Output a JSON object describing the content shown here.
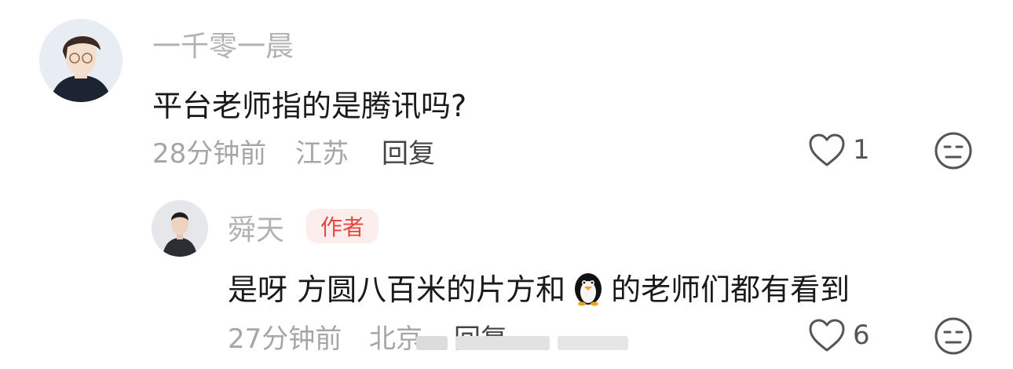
{
  "comment": {
    "username": "一千零一晨",
    "text": "平台老师指的是腾讯吗?",
    "time": "28分钟前",
    "location": "江苏",
    "reply_label": "回复",
    "likes": "1"
  },
  "reply": {
    "username": "舜天",
    "badge": "作者",
    "text_before": "是呀 方圆八百米的片方和",
    "text_after": "的老师们都有看到",
    "time": "27分钟前",
    "location": "北京",
    "reply_label": "回复",
    "likes": "6"
  },
  "icons": {
    "like": "heart-outline-icon",
    "dislike": "neutral-face-icon",
    "inline_emoji": "penguin-icon"
  }
}
